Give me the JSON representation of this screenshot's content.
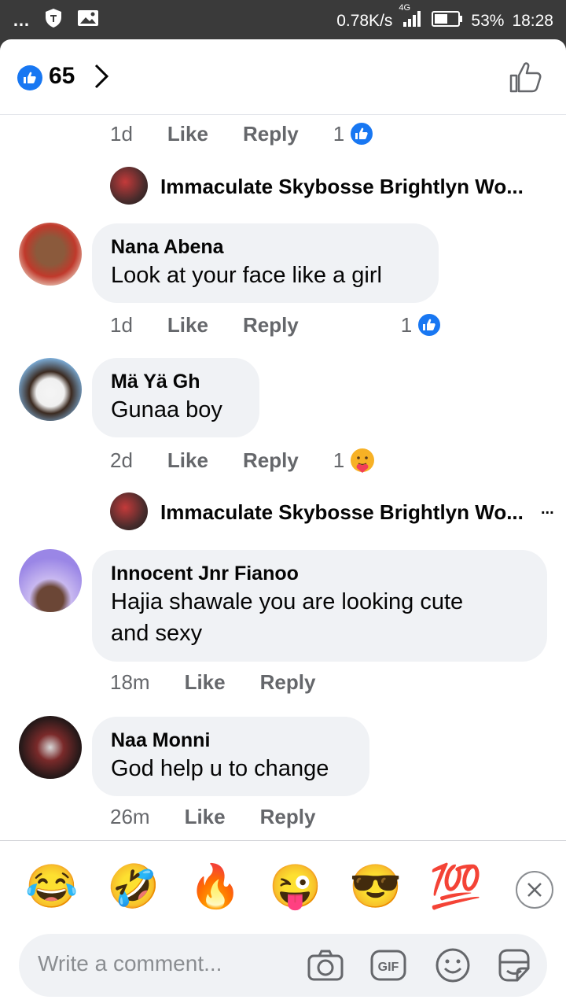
{
  "status": {
    "dots": "…",
    "speed": "0.78K/s",
    "network": "4G",
    "battery": "53%",
    "time": "18:28"
  },
  "header": {
    "like_count": "65"
  },
  "comments": [
    {
      "time": "1d",
      "like": "Like",
      "reply": "Reply",
      "reaction_count": "1"
    },
    {
      "reply_author": "Immaculate Skybosse Brightlyn Wo..."
    },
    {
      "name": "Nana Abena",
      "text": "Look at your face like a girl",
      "time": "1d",
      "like": "Like",
      "reply": "Reply",
      "reaction_count": "1"
    },
    {
      "name": "Mä Yä Gh",
      "text": "Gunaa boy",
      "time": "2d",
      "like": "Like",
      "reply": "Reply",
      "reaction_count": "1"
    },
    {
      "reply_author": "Immaculate Skybosse Brightlyn Wo...",
      "more": "..."
    },
    {
      "name": "Innocent Jnr Fianoo",
      "text_line1": "Hajia shawale you are looking cute",
      "text_line2": "and sexy",
      "time": "18m",
      "like": "Like",
      "reply": "Reply"
    },
    {
      "name": "Naa Monni",
      "text": "God help u to change",
      "time": "26m",
      "like": "Like",
      "reply": "Reply"
    }
  ],
  "emojis": [
    "😂",
    "🤣",
    "🔥",
    "😜",
    "😎",
    "💯"
  ],
  "composer": {
    "placeholder": "Write a comment..."
  },
  "colors": {
    "accent": "#1877f2",
    "bubble": "#f0f2f5",
    "muted": "#65676b"
  }
}
